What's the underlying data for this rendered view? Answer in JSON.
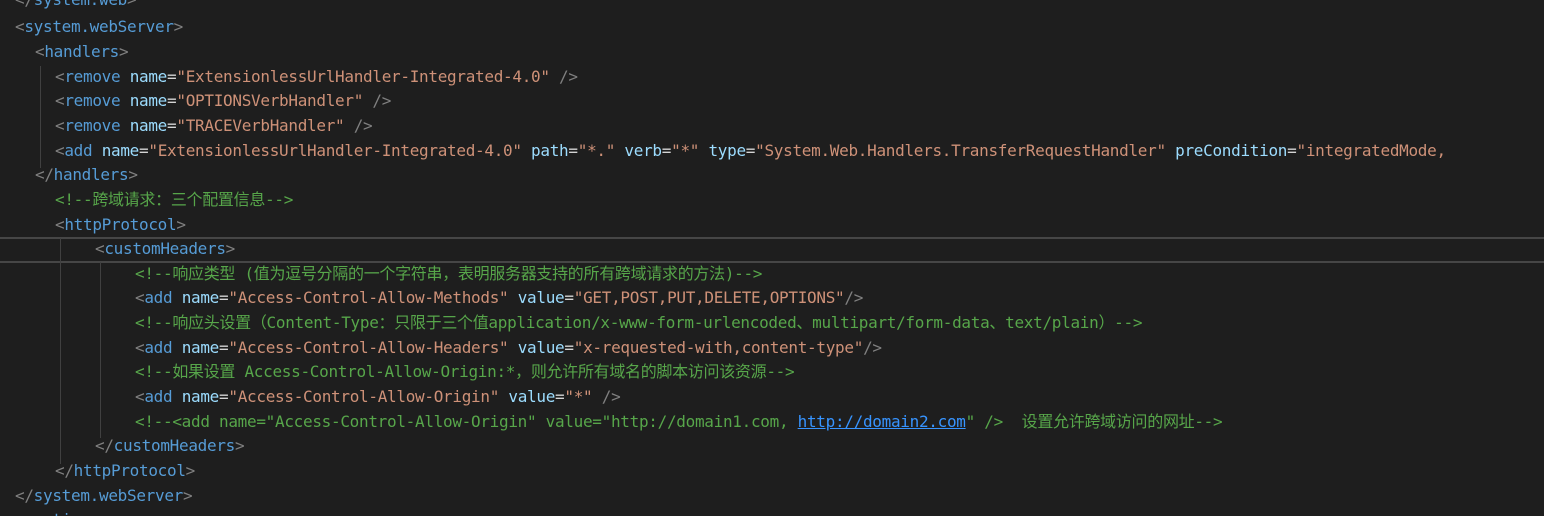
{
  "lines": [
    [
      {
        "k": "p",
        "t": "</"
      },
      {
        "k": "t",
        "t": "system.web"
      },
      {
        "k": "p",
        "t": ">"
      }
    ],
    [
      {
        "k": "p",
        "t": "<"
      },
      {
        "k": "t",
        "t": "system.webServer"
      },
      {
        "k": "p",
        "t": ">"
      }
    ],
    [
      {
        "k": "p",
        "t": "<"
      },
      {
        "k": "t",
        "t": "handlers"
      },
      {
        "k": "p",
        "t": ">"
      }
    ],
    [
      {
        "k": "p",
        "t": "<"
      },
      {
        "k": "t",
        "t": "remove"
      },
      {
        "k": "s",
        "t": " "
      },
      {
        "k": "a",
        "t": "name"
      },
      {
        "k": "s",
        "t": "="
      },
      {
        "k": "v",
        "t": "\"ExtensionlessUrlHandler-Integrated-4.0\""
      },
      {
        "k": "s",
        "t": " "
      },
      {
        "k": "p",
        "t": "/>"
      }
    ],
    [
      {
        "k": "p",
        "t": "<"
      },
      {
        "k": "t",
        "t": "remove"
      },
      {
        "k": "s",
        "t": " "
      },
      {
        "k": "a",
        "t": "name"
      },
      {
        "k": "s",
        "t": "="
      },
      {
        "k": "v",
        "t": "\"OPTIONSVerbHandler\""
      },
      {
        "k": "s",
        "t": " "
      },
      {
        "k": "p",
        "t": "/>"
      }
    ],
    [
      {
        "k": "p",
        "t": "<"
      },
      {
        "k": "t",
        "t": "remove"
      },
      {
        "k": "s",
        "t": " "
      },
      {
        "k": "a",
        "t": "name"
      },
      {
        "k": "s",
        "t": "="
      },
      {
        "k": "v",
        "t": "\"TRACEVerbHandler\""
      },
      {
        "k": "s",
        "t": " "
      },
      {
        "k": "p",
        "t": "/>"
      }
    ],
    [
      {
        "k": "p",
        "t": "<"
      },
      {
        "k": "t",
        "t": "add"
      },
      {
        "k": "s",
        "t": " "
      },
      {
        "k": "a",
        "t": "name"
      },
      {
        "k": "s",
        "t": "="
      },
      {
        "k": "v",
        "t": "\"ExtensionlessUrlHandler-Integrated-4.0\""
      },
      {
        "k": "s",
        "t": " "
      },
      {
        "k": "a",
        "t": "path"
      },
      {
        "k": "s",
        "t": "="
      },
      {
        "k": "v",
        "t": "\"*.\""
      },
      {
        "k": "s",
        "t": " "
      },
      {
        "k": "a",
        "t": "verb"
      },
      {
        "k": "s",
        "t": "="
      },
      {
        "k": "v",
        "t": "\"*\""
      },
      {
        "k": "s",
        "t": " "
      },
      {
        "k": "a",
        "t": "type"
      },
      {
        "k": "s",
        "t": "="
      },
      {
        "k": "v",
        "t": "\"System.Web.Handlers.TransferRequestHandler\""
      },
      {
        "k": "s",
        "t": " "
      },
      {
        "k": "a",
        "t": "preCondition"
      },
      {
        "k": "s",
        "t": "="
      },
      {
        "k": "v",
        "t": "\"integratedMode,"
      }
    ],
    [
      {
        "k": "p",
        "t": "</"
      },
      {
        "k": "t",
        "t": "handlers"
      },
      {
        "k": "p",
        "t": ">"
      }
    ],
    [
      {
        "k": "c",
        "t": "<!--跨域请求：三个配置信息-->"
      }
    ],
    [
      {
        "k": "p",
        "t": "<"
      },
      {
        "k": "t",
        "t": "httpProtocol"
      },
      {
        "k": "p",
        "t": ">"
      }
    ],
    [
      {
        "k": "p",
        "t": "<"
      },
      {
        "k": "t",
        "t": "customHeaders"
      },
      {
        "k": "p",
        "t": ">"
      }
    ],
    [
      {
        "k": "c",
        "t": "<!--响应类型 (值为逗号分隔的一个字符串，表明服务器支持的所有跨域请求的方法)-->"
      }
    ],
    [
      {
        "k": "p",
        "t": "<"
      },
      {
        "k": "t",
        "t": "add"
      },
      {
        "k": "s",
        "t": " "
      },
      {
        "k": "a",
        "t": "name"
      },
      {
        "k": "s",
        "t": "="
      },
      {
        "k": "v",
        "t": "\"Access-Control-Allow-Methods\""
      },
      {
        "k": "s",
        "t": " "
      },
      {
        "k": "a",
        "t": "value"
      },
      {
        "k": "s",
        "t": "="
      },
      {
        "k": "v",
        "t": "\"GET,POST,PUT,DELETE,OPTIONS\""
      },
      {
        "k": "p",
        "t": "/>"
      }
    ],
    [
      {
        "k": "c",
        "t": "<!--响应头设置（Content-Type：只限于三个值application/x-www-form-urlencoded、multipart/form-data、text/plain）-->"
      }
    ],
    [
      {
        "k": "p",
        "t": "<"
      },
      {
        "k": "t",
        "t": "add"
      },
      {
        "k": "s",
        "t": " "
      },
      {
        "k": "a",
        "t": "name"
      },
      {
        "k": "s",
        "t": "="
      },
      {
        "k": "v",
        "t": "\"Access-Control-Allow-Headers\""
      },
      {
        "k": "s",
        "t": " "
      },
      {
        "k": "a",
        "t": "value"
      },
      {
        "k": "s",
        "t": "="
      },
      {
        "k": "v",
        "t": "\"x-requested-with,content-type\""
      },
      {
        "k": "p",
        "t": "/>"
      }
    ],
    [
      {
        "k": "c",
        "t": "<!--如果设置 Access-Control-Allow-Origin:*，则允许所有域名的脚本访问该资源-->"
      }
    ],
    [
      {
        "k": "p",
        "t": "<"
      },
      {
        "k": "t",
        "t": "add"
      },
      {
        "k": "s",
        "t": " "
      },
      {
        "k": "a",
        "t": "name"
      },
      {
        "k": "s",
        "t": "="
      },
      {
        "k": "v",
        "t": "\"Access-Control-Allow-Origin\""
      },
      {
        "k": "s",
        "t": " "
      },
      {
        "k": "a",
        "t": "value"
      },
      {
        "k": "s",
        "t": "="
      },
      {
        "k": "v",
        "t": "\"*\""
      },
      {
        "k": "s",
        "t": " "
      },
      {
        "k": "p",
        "t": "/>"
      }
    ],
    [
      {
        "k": "c",
        "t": "<!--<add name=\"Access-Control-Allow-Origin\" value=\"http://domain1.com, "
      },
      {
        "k": "u",
        "t": "http://domain2.com"
      },
      {
        "k": "c",
        "t": "\" />  设置允许跨域访问的网址-->"
      }
    ],
    [
      {
        "k": "p",
        "t": "</"
      },
      {
        "k": "t",
        "t": "customHeaders"
      },
      {
        "k": "p",
        "t": ">"
      }
    ],
    [
      {
        "k": "p",
        "t": "</"
      },
      {
        "k": "t",
        "t": "httpProtocol"
      },
      {
        "k": "p",
        "t": ">"
      }
    ],
    [
      {
        "k": "p",
        "t": "</"
      },
      {
        "k": "t",
        "t": "system.webServer"
      },
      {
        "k": "p",
        "t": ">"
      }
    ],
    [
      {
        "k": "p",
        "t": "<"
      },
      {
        "k": "t",
        "t": "runtime"
      },
      {
        "k": "p",
        "t": ">"
      }
    ]
  ]
}
